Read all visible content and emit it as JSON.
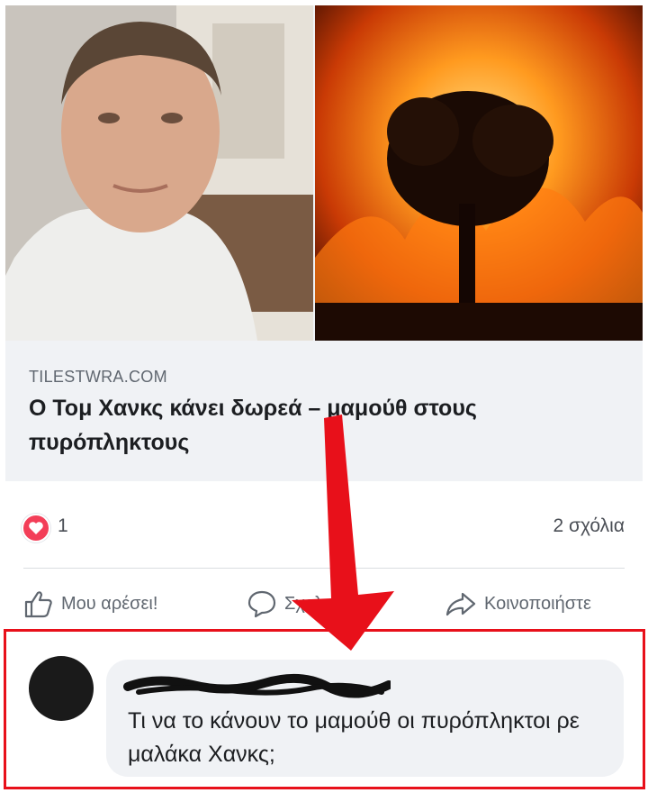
{
  "link_preview": {
    "domain": "TILESTWRA.COM",
    "title": "Ο Τομ Χανκς κάνει δωρεά – μαμούθ στους πυρόπληκτους"
  },
  "reactions": {
    "count": "1",
    "comments": "2 σχόλια"
  },
  "actions": {
    "like": "Μου αρέσει!",
    "comment": "Σχολιάστε",
    "share": "Κοινοποιήστε"
  },
  "comment": {
    "text": "Τι να το κάνουν το μαμούθ οι πυρόπληκτοι ρε μαλάκα Χανκς;"
  },
  "colors": {
    "highlight": "#e8101a",
    "heart": "#f33e58"
  }
}
